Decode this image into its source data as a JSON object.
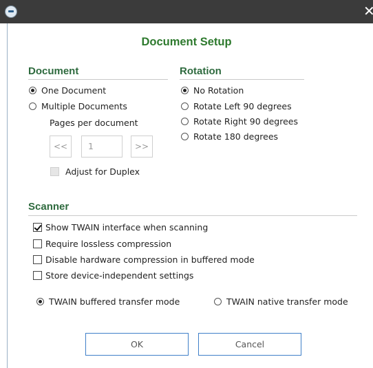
{
  "window": {
    "close_glyph": "✕",
    "app_icon": "app-icon"
  },
  "dialog": {
    "title": "Document Setup"
  },
  "document": {
    "heading": "Document",
    "options": [
      {
        "label": "One Document",
        "selected": true
      },
      {
        "label": "Multiple Documents",
        "selected": false
      }
    ],
    "pages_per_document_label": "Pages per document",
    "pager": {
      "prev_label": "<<",
      "value": "1",
      "next_label": ">>"
    },
    "adjust_duplex": {
      "label": "Adjust for Duplex",
      "checked": false,
      "enabled": false
    }
  },
  "rotation": {
    "heading": "Rotation",
    "options": [
      {
        "label": "No Rotation",
        "selected": true
      },
      {
        "label": "Rotate Left 90 degrees",
        "selected": false
      },
      {
        "label": "Rotate Right 90 degrees",
        "selected": false
      },
      {
        "label": "Rotate 180 degrees",
        "selected": false
      }
    ]
  },
  "scanner": {
    "heading": "Scanner",
    "checkboxes": [
      {
        "label": "Show TWAIN interface when scanning",
        "checked": true
      },
      {
        "label": "Require lossless compression",
        "checked": false
      },
      {
        "label": "Disable hardware compression in buffered mode",
        "checked": false
      },
      {
        "label": "Store device-independent settings",
        "checked": false
      }
    ],
    "transfer_modes": [
      {
        "label": "TWAIN buffered transfer mode",
        "selected": true
      },
      {
        "label": "TWAIN native transfer mode",
        "selected": false
      }
    ]
  },
  "buttons": {
    "ok_label": "OK",
    "cancel_label": "Cancel"
  },
  "colors": {
    "heading_green": "#2e7a2e",
    "titlebar": "#3b3b3b",
    "button_border": "#3f7fc8"
  }
}
